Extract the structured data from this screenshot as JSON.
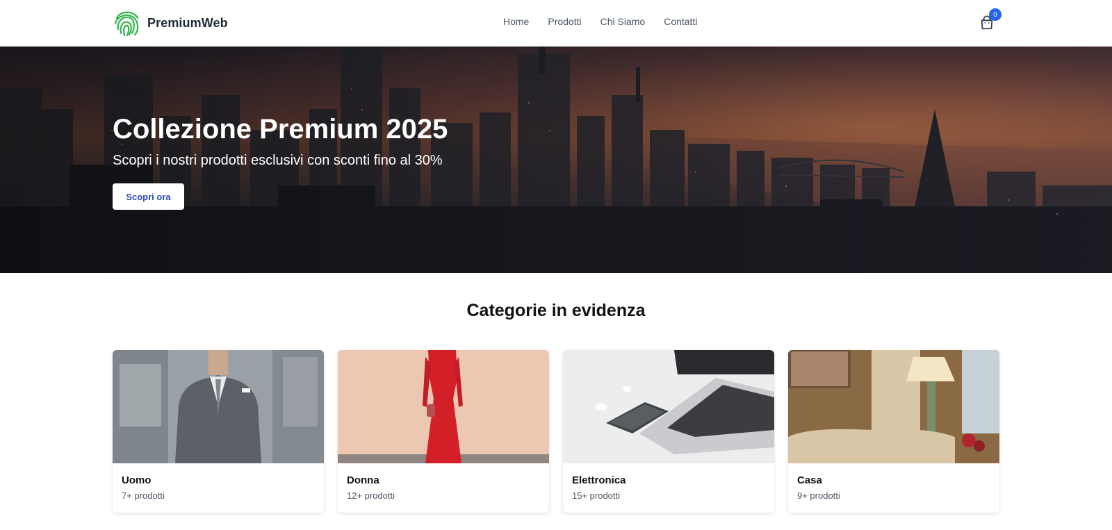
{
  "brand": {
    "name": "PremiumWeb",
    "logo_icon": "fingerprint-icon",
    "accent": "#2fb64a"
  },
  "nav": {
    "items": [
      {
        "label": "Home"
      },
      {
        "label": "Prodotti"
      },
      {
        "label": "Chi Siamo"
      },
      {
        "label": "Contatti"
      }
    ]
  },
  "cart": {
    "icon": "shopping-bag-icon",
    "count": "0",
    "badge_color": "#2563eb"
  },
  "hero": {
    "title": "Collezione Premium 2025",
    "subtitle": "Scopri i nostri prodotti esclusivi con sconti fino al 30%",
    "button_label": "Scopri ora",
    "button_text_color": "#2d4fb5"
  },
  "featured": {
    "title": "Categorie in evidenza",
    "categories": [
      {
        "name": "Uomo",
        "count": "7+ prodotti"
      },
      {
        "name": "Donna",
        "count": "12+ prodotti"
      },
      {
        "name": "Elettronica",
        "count": "15+ prodotti"
      },
      {
        "name": "Casa",
        "count": "9+ prodotti"
      }
    ]
  }
}
